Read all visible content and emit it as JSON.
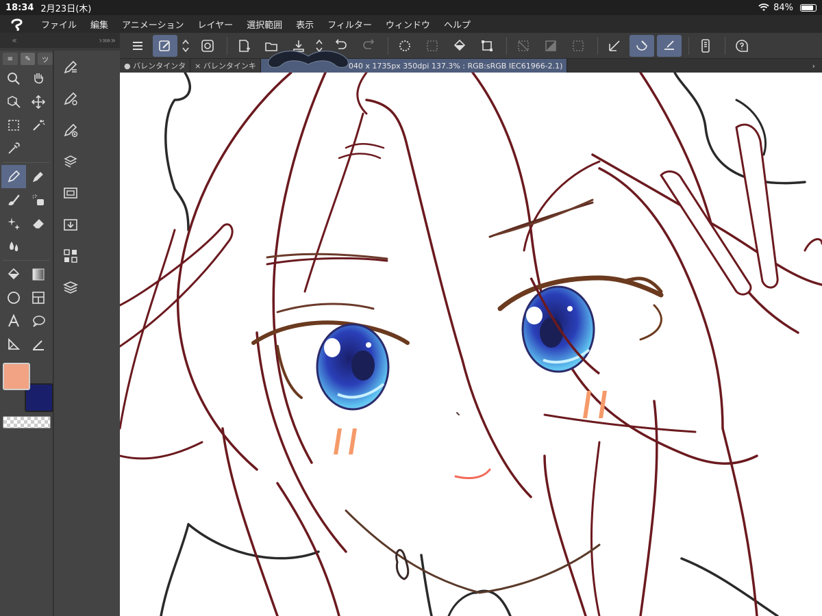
{
  "status_bar": {
    "time": "18:34",
    "date": "2月23日(木)",
    "battery": "84%",
    "battery_fill": 0.84
  },
  "menu": {
    "items": [
      "ファイル",
      "編集",
      "アニメーション",
      "レイヤー",
      "選択範囲",
      "表示",
      "フィルター",
      "ウィンドウ",
      "ヘルプ"
    ]
  },
  "left_strip": {
    "left_chevrons": "«",
    "right_chevrons": "› »» »"
  },
  "tool_tabs": [
    "≡",
    "✎",
    "ツ"
  ],
  "canvas_tabs": [
    {
      "label": "● バレンタインタ",
      "active": false
    },
    {
      "label": "× バレンタインキ",
      "active": false
    },
    {
      "label": "040 x 1735px 350dpi 137.3% : RGB:sRGB IEC61966-2.1)",
      "active": true
    }
  ],
  "colors": {
    "main": "#f2a384",
    "sub": "#1a1f6b",
    "accent": "#5b6a8a"
  },
  "icons": {
    "toolbar": [
      "menu-icon",
      "pen-settings-icon",
      "up-down-icon",
      "lasso-icon",
      "new-canvas-icon",
      "open-folder-icon",
      "save-icon",
      "up-down-icon",
      "undo-icon",
      "redo-icon",
      "loading-icon",
      "deselect-icon",
      "fill-icon",
      "transform-icon",
      "crop-icon",
      "gradient-fill-icon",
      "border-icon",
      "snap-ruler-icon",
      "snap-curve-icon",
      "snap-line-icon",
      "device-icon",
      "help-icon"
    ]
  }
}
